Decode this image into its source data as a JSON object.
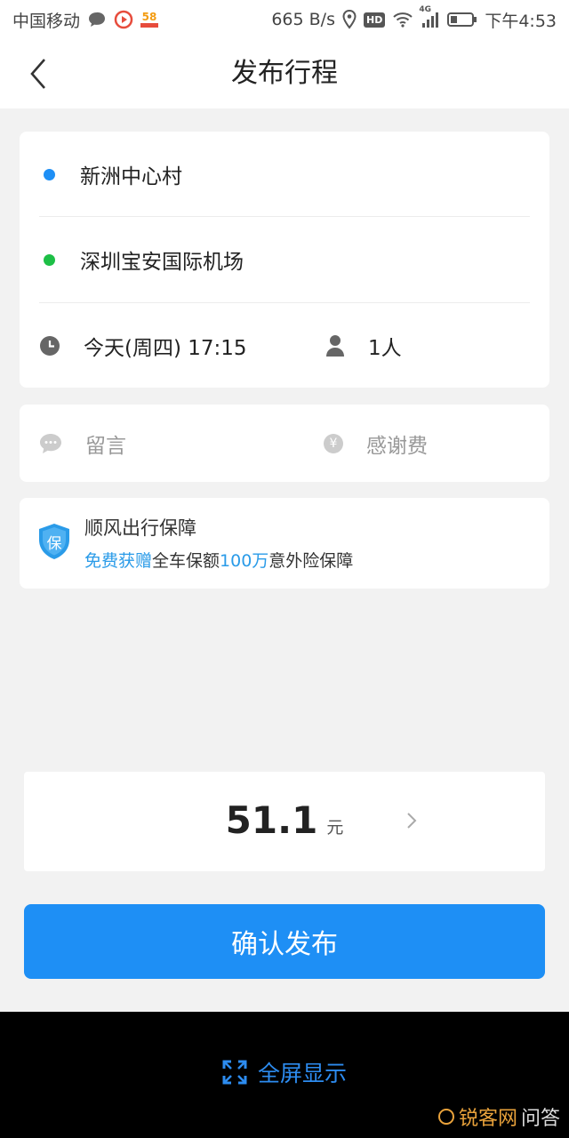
{
  "status_bar": {
    "carrier": "中国移动",
    "app_badge": "58",
    "network_speed": "665 B/s",
    "hd": "HD",
    "signal_label": "4G",
    "time": "下午4:53"
  },
  "header": {
    "title": "发布行程"
  },
  "trip": {
    "origin": "新洲中心村",
    "destination": "深圳宝安国际机场",
    "time": "今天(周四) 17:15",
    "passengers": "1人",
    "origin_dot_color": "#1e8ff5",
    "destination_dot_color": "#1dbf46"
  },
  "extras": {
    "message_placeholder": "留言",
    "thanks_fee_placeholder": "感谢费",
    "yuan_symbol": "¥"
  },
  "insurance": {
    "badge": "保",
    "title": "顺风出行保障",
    "desc_part1": "免费获赠",
    "desc_part2": "全车保额",
    "desc_part3": "100万",
    "desc_part4": "意外险保障",
    "accent_color": "#2a9be8"
  },
  "price": {
    "amount": "51.1",
    "unit": "元"
  },
  "actions": {
    "confirm_label": "确认发布"
  },
  "bottom": {
    "fullscreen_label": "全屏显示"
  },
  "watermark": {
    "text": "锐客网",
    "suffix": "问答"
  }
}
